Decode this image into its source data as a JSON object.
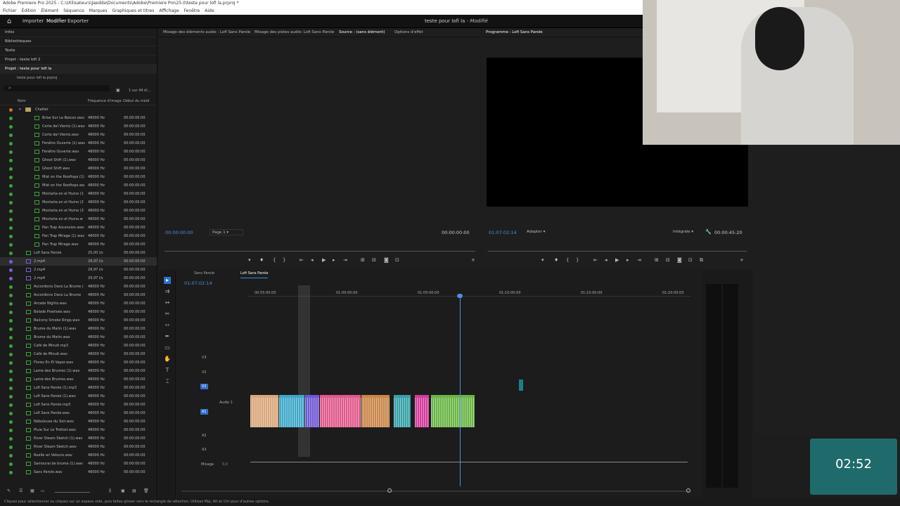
{
  "titlebar": {
    "text": "Adobe Premiere Pro 2025 - C:\\Utilisateurs\\Jaedda\\Documents\\Adobe\\Premiere Pro\\25.0\\teste pour lofi la.prproj *"
  },
  "menu": [
    "Fichier",
    "Édition",
    "Élément",
    "Séquence",
    "Marques",
    "Graphiques et titres",
    "Affichage",
    "Fenêtre",
    "Aide"
  ],
  "nav": {
    "import": "Importer",
    "edit": "Modifier",
    "export": "Exporter",
    "doc_title": "teste pour lofi la",
    "doc_status": " - Modifié"
  },
  "left_tabs": [
    "Infos",
    "Bibliothèques",
    "Texte",
    "Projet : teste lofi 2"
  ],
  "project": {
    "header": "Projet : teste pour lofi la",
    "file": "teste pour lofi la.prproj",
    "item_count": "1 sur 44 él...",
    "col_name": "Nom",
    "col_framerate": "Fréquence d'image",
    "col_start": "Début du médi",
    "folder": "Chatter",
    "items": [
      {
        "name": "Brise Sur Le Balcon.wav",
        "rate": "48000  Hz",
        "tc": "00:00:00:00",
        "color": "#3aa33a",
        "indent": 1
      },
      {
        "name": "Corte del Viento (1).wav",
        "rate": "48000  Hz",
        "tc": "00:00:00:00",
        "color": "#3aa33a",
        "indent": 1
      },
      {
        "name": "Corte del Viento.wav",
        "rate": "48000  Hz",
        "tc": "00:00:00:00",
        "color": "#3aa33a",
        "indent": 1
      },
      {
        "name": "Fenêtre Ouverte (1).wav",
        "rate": "48000  Hz",
        "tc": "00:00:00:00",
        "color": "#3aa33a",
        "indent": 1
      },
      {
        "name": "Fenêtre Ouverte.wav",
        "rate": "48000  Hz",
        "tc": "00:00:00:00",
        "color": "#3aa33a",
        "indent": 1
      },
      {
        "name": "Ghost Shift (1).wav",
        "rate": "48000  Hz",
        "tc": "00:00:00:00",
        "color": "#3aa33a",
        "indent": 1
      },
      {
        "name": "Ghost Shift.wav",
        "rate": "48000  Hz",
        "tc": "00:00:00:00",
        "color": "#3aa33a",
        "indent": 1
      },
      {
        "name": "Mist on the Rooftops (1)",
        "rate": "48000  Hz",
        "tc": "00:00:00:00",
        "color": "#3aa33a",
        "indent": 1
      },
      {
        "name": "Mist on the Rooftops.wa",
        "rate": "48000  Hz",
        "tc": "00:00:00:00",
        "color": "#3aa33a",
        "indent": 1
      },
      {
        "name": "Montaña en el Humo (1",
        "rate": "48000  Hz",
        "tc": "00:00:00:00",
        "color": "#3aa33a",
        "indent": 1
      },
      {
        "name": "Montaña en el Humo (2",
        "rate": "48000  Hz",
        "tc": "00:00:00:00",
        "color": "#3aa33a",
        "indent": 1
      },
      {
        "name": "Montaña en el Humo (3",
        "rate": "48000  Hz",
        "tc": "00:00:00:00",
        "color": "#3aa33a",
        "indent": 1
      },
      {
        "name": "Montaña en el Humo.w",
        "rate": "48000  Hz",
        "tc": "00:00:00:00",
        "color": "#3aa33a",
        "indent": 1
      },
      {
        "name": "Pan Trap Ascension.wav",
        "rate": "48000  Hz",
        "tc": "00:00:00:00",
        "color": "#3aa33a",
        "indent": 1
      },
      {
        "name": "Pan Trap Mirage (1).wav",
        "rate": "48000  Hz",
        "tc": "00:00:00:00",
        "color": "#3aa33a",
        "indent": 1
      },
      {
        "name": "Pan Trap Mirage.wav",
        "rate": "48000  Hz",
        "tc": "00:00:00:00",
        "color": "#3aa33a",
        "indent": 1
      },
      {
        "name": "Lofi Sans Parole",
        "rate": "25,00 i/s",
        "tc": "00:00:00:00",
        "color": "#3aa33a",
        "indent": 0
      },
      {
        "name": "2.mp4",
        "rate": "29,97 i/s",
        "tc": "00:00:00:00",
        "color": "#7b5fd6",
        "indent": 0,
        "selected": true
      },
      {
        "name": "2.mp4",
        "rate": "29,97 i/s",
        "tc": "00:00:00:00",
        "color": "#7b5fd6",
        "indent": 0
      },
      {
        "name": "2.mp4",
        "rate": "29,97 i/s",
        "tc": "00:00:00:00",
        "color": "#7b5fd6",
        "indent": 0
      },
      {
        "name": "Accordions Dans La Brume (",
        "rate": "48000  Hz",
        "tc": "00:00:00:00",
        "color": "#3aa33a",
        "indent": 0
      },
      {
        "name": "Accordions Dans La Brume",
        "rate": "48000  Hz",
        "tc": "00:00:00:00",
        "color": "#3aa33a",
        "indent": 0
      },
      {
        "name": "Arcade Nights.wav",
        "rate": "48000  Hz",
        "tc": "00:00:00:00",
        "color": "#3aa33a",
        "indent": 0
      },
      {
        "name": "Balade Pixelisée.wav",
        "rate": "48000  Hz",
        "tc": "00:00:00:00",
        "color": "#3aa33a",
        "indent": 0
      },
      {
        "name": "Balcony Smoke Rings.wav",
        "rate": "48000  Hz",
        "tc": "00:00:00:00",
        "color": "#3aa33a",
        "indent": 0
      },
      {
        "name": "Brume du Matin (1).wav",
        "rate": "48000  Hz",
        "tc": "00:00:00:00",
        "color": "#3aa33a",
        "indent": 0
      },
      {
        "name": "Brume du Matin.wav",
        "rate": "48000  Hz",
        "tc": "00:00:00:00",
        "color": "#3aa33a",
        "indent": 0
      },
      {
        "name": "Café de Minuit.mp3",
        "rate": "48000  Hz",
        "tc": "00:00:00:00",
        "color": "#3aa33a",
        "indent": 0
      },
      {
        "name": "Café de Minuit.wav",
        "rate": "48000  Hz",
        "tc": "00:00:00:00",
        "color": "#3aa33a",
        "indent": 0
      },
      {
        "name": "Flores En El Vapor.wav",
        "rate": "48000  Hz",
        "tc": "00:00:00:00",
        "color": "#3aa33a",
        "indent": 0
      },
      {
        "name": "Lame des Brumes (1).wav",
        "rate": "48000  Hz",
        "tc": "00:00:00:00",
        "color": "#3aa33a",
        "indent": 0
      },
      {
        "name": "Lame des Brumes.wav",
        "rate": "48000  Hz",
        "tc": "00:00:00:00",
        "color": "#3aa33a",
        "indent": 0
      },
      {
        "name": "Lofi Sans Parole (1).mp3",
        "rate": "48000  Hz",
        "tc": "00:00:00:00",
        "color": "#3aa33a",
        "indent": 0
      },
      {
        "name": "Lofi Sans Parole (1).wav",
        "rate": "48000  Hz",
        "tc": "00:00:00:00",
        "color": "#3aa33a",
        "indent": 0
      },
      {
        "name": "Lofi Sans Parole.mp3",
        "rate": "48000  Hz",
        "tc": "00:00:00:00",
        "color": "#3aa33a",
        "indent": 0
      },
      {
        "name": "Lofi Sans Parole.wav",
        "rate": "48000  Hz",
        "tc": "00:00:00:00",
        "color": "#3aa33a",
        "indent": 0
      },
      {
        "name": "Nébuleuse du Soir.wav",
        "rate": "48000  Hz",
        "tc": "00:00:00:00",
        "color": "#3aa33a",
        "indent": 0
      },
      {
        "name": "Pluie Sur Le Trottoir.wav",
        "rate": "48000  Hz",
        "tc": "00:00:00:00",
        "color": "#3aa33a",
        "indent": 0
      },
      {
        "name": "River Steam Sketch (1).wav",
        "rate": "48000  Hz",
        "tc": "00:00:00:00",
        "color": "#3aa33a",
        "indent": 0
      },
      {
        "name": "River Steam Sketch.wav",
        "rate": "48000  Hz",
        "tc": "00:00:00:00",
        "color": "#3aa33a",
        "indent": 0
      },
      {
        "name": "Ruelle en Velours.wav",
        "rate": "48000  Hz",
        "tc": "00:00:00:00",
        "color": "#3aa33a",
        "indent": 0
      },
      {
        "name": "Samourai de brume (1).wav",
        "rate": "48000  Hz",
        "tc": "00:00:00:00",
        "color": "#3aa33a",
        "indent": 0
      },
      {
        "name": "Sans Parole.wav",
        "rate": "48000  Hz",
        "tc": "00:00:00:00",
        "color": "#3aa33a",
        "indent": 0
      }
    ]
  },
  "source": {
    "tabs": [
      "Mixage des éléments audio : Lofi Sans Parole",
      "Mixage des pistes audio: Lofi Sans Parole",
      "Source : (sans élément)",
      "Options d'effet"
    ],
    "tc_left": "00:00:00:00",
    "page": "Page 1",
    "tc_right": "00:00:00:00"
  },
  "program": {
    "tab": "Programme : Lofi Sans Parole",
    "tc": "01:07:02:14",
    "fit": "Adapter",
    "quality": "Intégrale",
    "duration": "00:00:45:20"
  },
  "timeline": {
    "tabs": [
      "Sans Parole",
      "Lofi Sans Parole"
    ],
    "tc": "01:07:02:14",
    "ruler": [
      "00:55:00:00",
      "01:00:00:00",
      "01:05:00:00",
      "01:10:00:00",
      "01:15:00:00",
      "01:20:00:00"
    ],
    "tracks": [
      "V3",
      "V2",
      "V1",
      "A1",
      "A2",
      "A3"
    ],
    "audio1_name": "Audio 1",
    "mix_label": "Mixage",
    "mix_value": "0,0"
  },
  "status": "Cliquez pour sélectionner ou cliquez sur un espace vide, puis faites glisser vers le rectangle de sélection. Utilisez Maj, Alt et Ctrl pour d'autres options.",
  "widget": {
    "time": "02:52"
  },
  "colors": {
    "accent": "#2d8ceb",
    "playhead": "#4f8fe0",
    "audio_green": "#3aa33a",
    "video_purple": "#7b5fd6"
  }
}
